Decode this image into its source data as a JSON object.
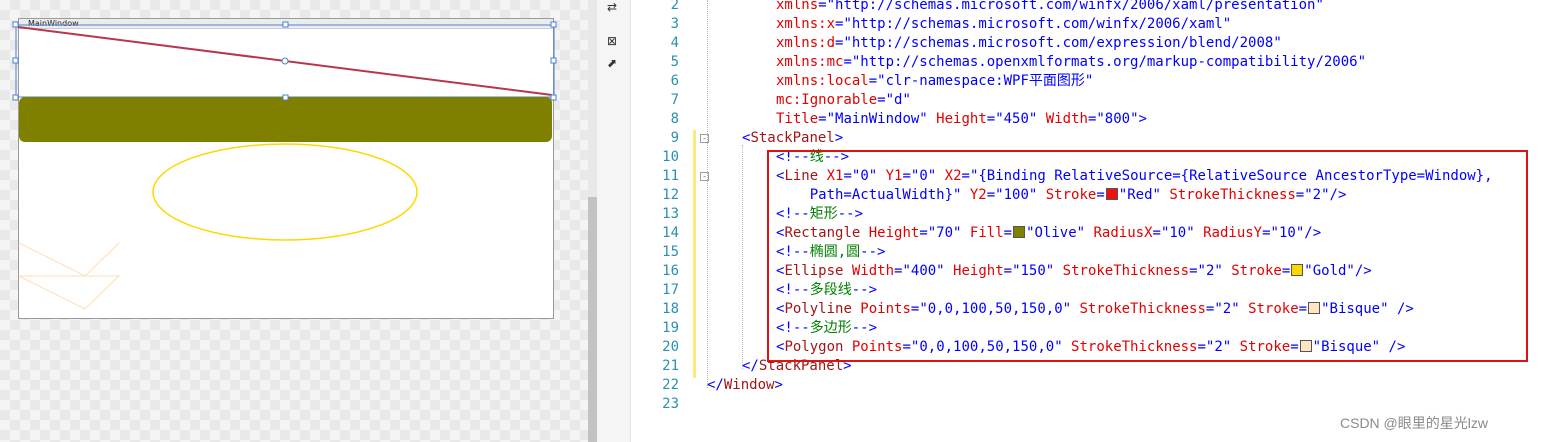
{
  "designer": {
    "window_title": "MainWindow",
    "colors": {
      "line_stroke": "#b5374f",
      "rectangle_fill": "#808000",
      "ellipse_stroke": "#ffd700",
      "polyline_stroke": "#ffe4c4",
      "selection": "#4a7fd4"
    }
  },
  "toolbar": {
    "icons": [
      "swap-icon",
      "close-box-icon",
      "open-external-icon"
    ],
    "swap_glyph": "⇄",
    "close_glyph": "⊠",
    "external_glyph": "⬈"
  },
  "editor": {
    "lines": [
      {
        "n": "2",
        "parts": [
          [
            "attr",
            "xmlns"
          ],
          [
            "punc",
            "="
          ],
          [
            "val",
            "\"http://schemas.microsoft.com/winfx/2006/xaml/presentation\""
          ]
        ]
      },
      {
        "n": "3",
        "parts": [
          [
            "attr",
            "xmlns:x"
          ],
          [
            "punc",
            "="
          ],
          [
            "val",
            "\"http://schemas.microsoft.com/winfx/2006/xaml\""
          ]
        ]
      },
      {
        "n": "4",
        "parts": [
          [
            "attr",
            "xmlns:d"
          ],
          [
            "punc",
            "="
          ],
          [
            "val",
            "\"http://schemas.microsoft.com/expression/blend/2008\""
          ]
        ]
      },
      {
        "n": "5",
        "parts": [
          [
            "attr",
            "xmlns:mc"
          ],
          [
            "punc",
            "="
          ],
          [
            "val",
            "\"http://schemas.openxmlformats.org/markup-compatibility/2006\""
          ]
        ]
      },
      {
        "n": "6",
        "parts": [
          [
            "attr",
            "xmlns:local"
          ],
          [
            "punc",
            "="
          ],
          [
            "val",
            "\"clr-namespace:WPF平面图形\""
          ]
        ]
      },
      {
        "n": "7",
        "parts": [
          [
            "attr",
            "mc:Ignorable"
          ],
          [
            "punc",
            "="
          ],
          [
            "val",
            "\"d\""
          ]
        ]
      },
      {
        "n": "8",
        "parts": [
          [
            "attr",
            "Title"
          ],
          [
            "punc",
            "="
          ],
          [
            "val",
            "\"MainWindow\""
          ],
          [
            "attr",
            " Height"
          ],
          [
            "punc",
            "="
          ],
          [
            "val",
            "\"450\""
          ],
          [
            "attr",
            " Width"
          ],
          [
            "punc",
            "="
          ],
          [
            "val",
            "\"800\""
          ],
          [
            "punc",
            ">"
          ]
        ]
      },
      {
        "n": "9",
        "parts": [
          [
            "punc",
            "<"
          ],
          [
            "tag",
            "StackPanel"
          ],
          [
            "punc",
            ">"
          ]
        ]
      },
      {
        "n": "10",
        "parts": [
          [
            "punc",
            "<!--"
          ],
          [
            "cmt",
            "线"
          ],
          [
            "punc",
            "-->"
          ]
        ]
      },
      {
        "n": "11",
        "parts": [
          [
            "punc",
            "<"
          ],
          [
            "tag",
            "Line"
          ],
          [
            "attr",
            " X1"
          ],
          [
            "punc",
            "="
          ],
          [
            "val",
            "\"0\""
          ],
          [
            "attr",
            " Y1"
          ],
          [
            "punc",
            "="
          ],
          [
            "val",
            "\"0\""
          ],
          [
            "attr",
            " X2"
          ],
          [
            "punc",
            "="
          ],
          [
            "val",
            "\"{Binding RelativeSource={RelativeSource AncestorType=Window},"
          ]
        ]
      },
      {
        "n": "12",
        "parts": [
          [
            "val",
            "    Path=ActualWidth}\""
          ],
          [
            "attr",
            " Y2"
          ],
          [
            "punc",
            "="
          ],
          [
            "val",
            "\"100\""
          ],
          [
            "attr",
            " Stroke"
          ],
          [
            "punc",
            "="
          ],
          [
            "swatch",
            "#ee1111"
          ],
          [
            "val",
            "\"Red\""
          ],
          [
            "attr",
            " StrokeThickness"
          ],
          [
            "punc",
            "="
          ],
          [
            "val",
            "\"2\""
          ],
          [
            "punc",
            "/>"
          ]
        ]
      },
      {
        "n": "13",
        "parts": [
          [
            "punc",
            "<!--"
          ],
          [
            "cmt",
            "矩形"
          ],
          [
            "punc",
            "-->"
          ]
        ]
      },
      {
        "n": "14",
        "parts": [
          [
            "punc",
            "<"
          ],
          [
            "tag",
            "Rectangle"
          ],
          [
            "attr",
            " Height"
          ],
          [
            "punc",
            "="
          ],
          [
            "val",
            "\"70\""
          ],
          [
            "attr",
            " Fill"
          ],
          [
            "punc",
            "="
          ],
          [
            "swatch",
            "#808000"
          ],
          [
            "val",
            "\"Olive\""
          ],
          [
            "attr",
            " RadiusX"
          ],
          [
            "punc",
            "="
          ],
          [
            "val",
            "\"10\""
          ],
          [
            "attr",
            " RadiusY"
          ],
          [
            "punc",
            "="
          ],
          [
            "val",
            "\"10\""
          ],
          [
            "punc",
            "/>"
          ]
        ]
      },
      {
        "n": "15",
        "parts": [
          [
            "punc",
            "<!--"
          ],
          [
            "cmt",
            "椭圆,圆"
          ],
          [
            "punc",
            "-->"
          ]
        ]
      },
      {
        "n": "16",
        "parts": [
          [
            "punc",
            "<"
          ],
          [
            "tag",
            "Ellipse"
          ],
          [
            "attr",
            " Width"
          ],
          [
            "punc",
            "="
          ],
          [
            "val",
            "\"400\""
          ],
          [
            "attr",
            " Height"
          ],
          [
            "punc",
            "="
          ],
          [
            "val",
            "\"150\""
          ],
          [
            "attr",
            " StrokeThickness"
          ],
          [
            "punc",
            "="
          ],
          [
            "val",
            "\"2\""
          ],
          [
            "attr",
            " Stroke"
          ],
          [
            "punc",
            "="
          ],
          [
            "swatch",
            "#ffd700"
          ],
          [
            "val",
            "\"Gold\""
          ],
          [
            "punc",
            "/>"
          ]
        ]
      },
      {
        "n": "17",
        "parts": [
          [
            "punc",
            "<!--"
          ],
          [
            "cmt",
            "多段线"
          ],
          [
            "punc",
            "-->"
          ]
        ]
      },
      {
        "n": "18",
        "parts": [
          [
            "punc",
            "<"
          ],
          [
            "tag",
            "Polyline"
          ],
          [
            "attr",
            " Points"
          ],
          [
            "punc",
            "="
          ],
          [
            "val",
            "\"0,0,100,50,150,0\""
          ],
          [
            "attr",
            " StrokeThickness"
          ],
          [
            "punc",
            "="
          ],
          [
            "val",
            "\"2\""
          ],
          [
            "attr",
            " Stroke"
          ],
          [
            "punc",
            "="
          ],
          [
            "swatch",
            "#ffe4c4"
          ],
          [
            "val",
            "\"Bisque\""
          ],
          [
            "punc",
            " />"
          ]
        ]
      },
      {
        "n": "19",
        "parts": [
          [
            "punc",
            "<!--"
          ],
          [
            "cmt",
            "多边形"
          ],
          [
            "punc",
            "-->"
          ]
        ]
      },
      {
        "n": "20",
        "parts": [
          [
            "punc",
            "<"
          ],
          [
            "tag",
            "Polygon"
          ],
          [
            "attr",
            " Points"
          ],
          [
            "punc",
            "="
          ],
          [
            "val",
            "\"0,0,100,50,150,0\""
          ],
          [
            "attr",
            " StrokeThickness"
          ],
          [
            "punc",
            "="
          ],
          [
            "val",
            "\"2\""
          ],
          [
            "attr",
            " Stroke"
          ],
          [
            "punc",
            "="
          ],
          [
            "swatch",
            "#ffe4c4"
          ],
          [
            "val",
            "\"Bisque\""
          ],
          [
            "punc",
            " />"
          ]
        ]
      },
      {
        "n": "21",
        "parts": [
          [
            "punc",
            "</"
          ],
          [
            "tag",
            "StackPanel"
          ],
          [
            "punc",
            ">"
          ]
        ]
      },
      {
        "n": "22",
        "parts": [
          [
            "punc",
            "</"
          ],
          [
            "tag",
            "Window"
          ],
          [
            "punc",
            ">"
          ]
        ]
      },
      {
        "n": "23",
        "parts": []
      }
    ]
  },
  "watermark": "CSDN @眼里的星光lzw"
}
